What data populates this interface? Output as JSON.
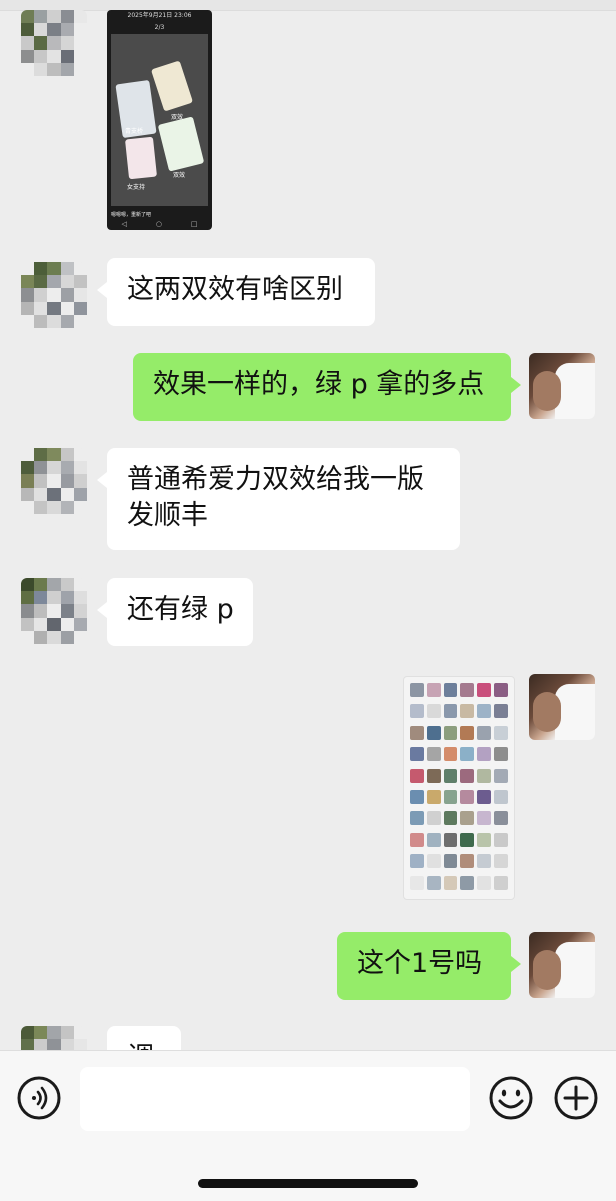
{
  "messages": [
    {
      "id": "m1",
      "from": "contact",
      "type": "image",
      "screenshot": {
        "status_time": "2025年9月21日 23:06",
        "page_indicator": "2/3",
        "labels": [
          "青支桥",
          "双效",
          "女支持",
          "双效"
        ],
        "caption": "嗯嗯嗯，重新了吧"
      }
    },
    {
      "id": "m2",
      "from": "contact",
      "type": "text",
      "text": "这两双效有啥区别"
    },
    {
      "id": "m3",
      "from": "self",
      "type": "text",
      "text": "效果一样的，绿 p 拿的多点"
    },
    {
      "id": "m4",
      "from": "contact",
      "type": "text",
      "lines": [
        "普通希爱力双效给我一版",
        "发顺丰"
      ]
    },
    {
      "id": "m5",
      "from": "contact",
      "type": "text",
      "text": "还有绿 p"
    },
    {
      "id": "m6",
      "from": "self",
      "type": "image"
    },
    {
      "id": "m7",
      "from": "self",
      "type": "text",
      "text": "这个1号吗"
    },
    {
      "id": "m8",
      "from": "contact",
      "type": "text",
      "text": "调"
    }
  ],
  "input_bar": {
    "voice_icon": "voice-icon",
    "emoji_icon": "emoji-icon",
    "more_icon": "plus-icon",
    "draft": ""
  },
  "colors": {
    "background": "#ededed",
    "incoming_bubble": "#ffffff",
    "outgoing_bubble": "#95ec69"
  }
}
